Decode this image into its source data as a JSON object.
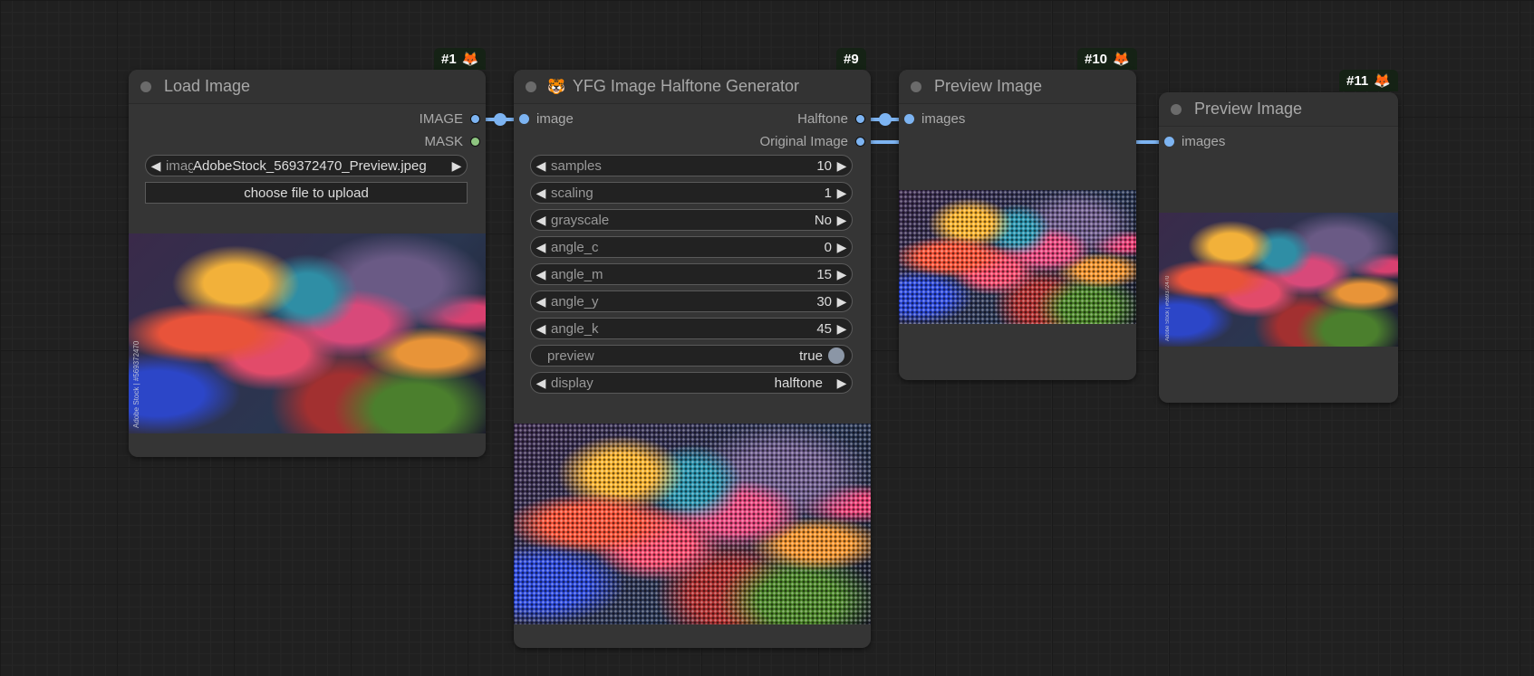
{
  "colors": {
    "image_link": "#7db4f2",
    "mask_slot": "#8ec580",
    "badge_bg": "#152215",
    "node_bg": "#353535"
  },
  "nodes": {
    "load_image": {
      "id_badge": "#1",
      "badge_icon": "fox-icon",
      "badge_emoji": "🦊",
      "title": "Load Image",
      "outputs": [
        "IMAGE",
        "MASK"
      ],
      "image_widget": {
        "label": "image",
        "value": "AdobeStock_569372470_Preview.jpeg"
      },
      "upload_button": "choose file to upload",
      "watermark": "Adobe Stock | #569372470"
    },
    "halftone": {
      "id_badge": "#9",
      "title_emoji": "🐯",
      "title": "YFG Image Halftone Generator",
      "inputs": [
        "image"
      ],
      "outputs": [
        "Halftone",
        "Original Image"
      ],
      "widgets": [
        {
          "label": "samples",
          "value": "10"
        },
        {
          "label": "scaling",
          "value": "1"
        },
        {
          "label": "grayscale",
          "value": "No"
        },
        {
          "label": "angle_c",
          "value": "0"
        },
        {
          "label": "angle_m",
          "value": "15"
        },
        {
          "label": "angle_y",
          "value": "30"
        },
        {
          "label": "angle_k",
          "value": "45"
        }
      ],
      "preview_toggle": {
        "label": "preview",
        "value": "true"
      },
      "display_widget": {
        "label": "display",
        "value": "halftone"
      }
    },
    "preview_10": {
      "id_badge": "#10",
      "badge_emoji": "🦊",
      "title": "Preview Image",
      "inputs": [
        "images"
      ]
    },
    "preview_11": {
      "id_badge": "#11",
      "badge_emoji": "🦊",
      "title": "Preview Image",
      "inputs": [
        "images"
      ],
      "watermark": "Adobe Stock | #569372470"
    }
  }
}
